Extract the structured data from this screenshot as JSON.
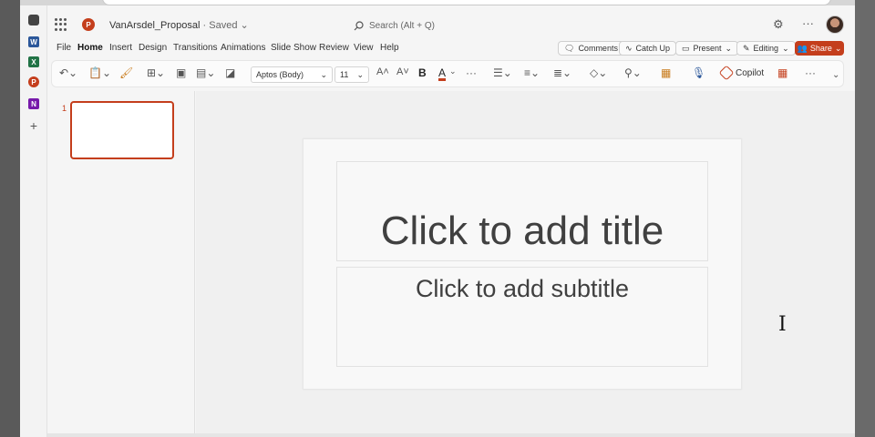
{
  "app": {
    "logo_letter": "P",
    "title": "VanArsdel_Proposal",
    "status": "Saved",
    "brand_color": "#c43e1c"
  },
  "search": {
    "placeholder": "Search (Alt + Q)"
  },
  "rail": [
    {
      "name": "onedrive-icon",
      "letter": "",
      "color": "#444444"
    },
    {
      "name": "word-icon",
      "letter": "W",
      "color": "#2b579a"
    },
    {
      "name": "excel-icon",
      "letter": "X",
      "color": "#217346"
    },
    {
      "name": "powerpoint-icon",
      "letter": "P",
      "color": "#c43e1c"
    },
    {
      "name": "onenote-icon",
      "letter": "N",
      "color": "#7719aa"
    }
  ],
  "menu": {
    "items": [
      "File",
      "Home",
      "Insert",
      "Design",
      "Transitions",
      "Animations",
      "Slide Show",
      "Review",
      "View",
      "Help"
    ],
    "active": "Home"
  },
  "actions": {
    "comments": "Comments",
    "catch_up": "Catch Up",
    "present": "Present",
    "editing": "Editing",
    "share": "Share"
  },
  "ribbon": {
    "font_name": "Aptos (Body)",
    "font_size": "11",
    "copilot": "Copilot"
  },
  "slides": {
    "current_number": "1"
  },
  "slide": {
    "title_placeholder": "Click to add title",
    "subtitle_placeholder": "Click to add subtitle"
  }
}
